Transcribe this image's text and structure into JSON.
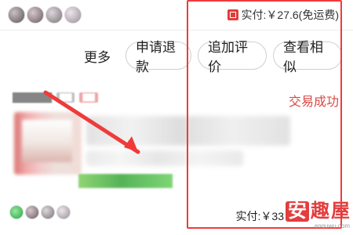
{
  "top": {
    "summary": "实付:￥27.6(免运费)"
  },
  "actions": {
    "more": "更多",
    "refund": "申请退款",
    "review": "追加评价",
    "similar": "查看相似"
  },
  "order": {
    "status": "交易成功",
    "paid_bottom": "实付:￥33"
  },
  "watermark": {
    "brand": "安趣屋",
    "domain": "anquwu.com"
  },
  "colors": {
    "accent_red": "#f03a3a",
    "status_red": "#d64a45"
  }
}
